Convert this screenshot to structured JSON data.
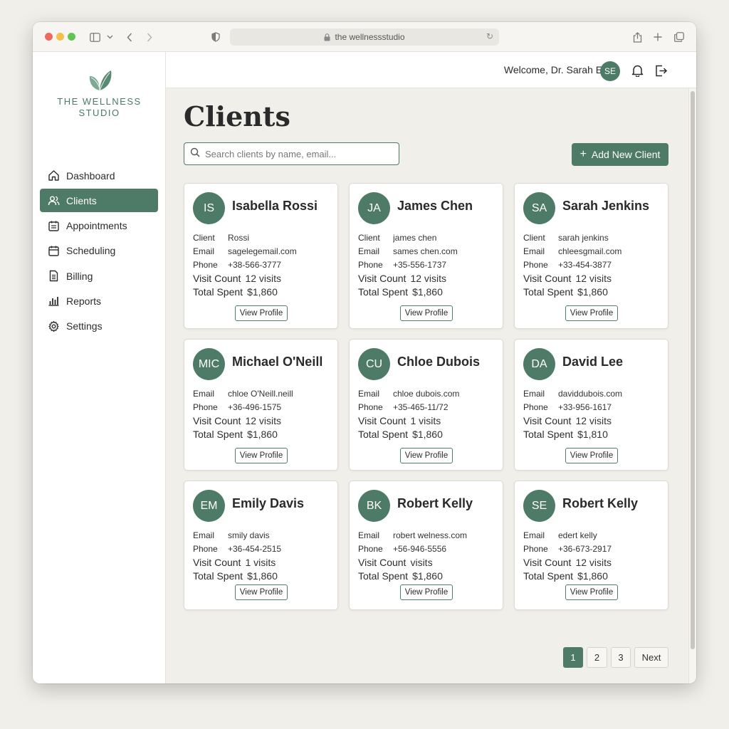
{
  "browser": {
    "url": "the wellnessstudio"
  },
  "brand": {
    "name_line1": "THE WELLNESS",
    "name_line2": "STUDIO",
    "accent_color": "#4e7b67"
  },
  "sidebar": {
    "items": [
      {
        "label": "Dashboard",
        "icon": "home-icon",
        "active": false
      },
      {
        "label": "Clients",
        "icon": "users-icon",
        "active": true
      },
      {
        "label": "Appointments",
        "icon": "calendar-list-icon",
        "active": false
      },
      {
        "label": "Scheduling",
        "icon": "calendar-icon",
        "active": false
      },
      {
        "label": "Billing",
        "icon": "document-icon",
        "active": false
      },
      {
        "label": "Reports",
        "icon": "bar-chart-icon",
        "active": false
      },
      {
        "label": "Settings",
        "icon": "gear-icon",
        "active": false
      }
    ]
  },
  "header": {
    "welcome": "Welcome, Dr. Sarah E.",
    "avatar_initials": "SE"
  },
  "main": {
    "title": "Clients",
    "search_placeholder": "Search clients by name, email...",
    "add_button": "Add New Client",
    "view_profile_label": "View Profile"
  },
  "labels": {
    "client": "Client",
    "email": "Email",
    "phone": "Phone",
    "visit_count": "Visit Count",
    "total_spent": "Total Spent"
  },
  "clients": [
    {
      "initials": "IS",
      "name": "Isabella Rossi",
      "client": "Rossi",
      "email": "sagelegemail.com",
      "phone": "+38-566-3777",
      "visits": "12 visits",
      "spent": "$1,860"
    },
    {
      "initials": "JA",
      "name": "James Chen",
      "client": "james chen",
      "email": "sames chen.com",
      "phone": "+35-556-1737",
      "visits": "12 visits",
      "spent": "$1,860"
    },
    {
      "initials": "SA",
      "name": "Sarah Jenkins",
      "client": "sarah jenkins",
      "email": "chleesgmail.com",
      "phone": "+33-454-3877",
      "visits": "12 visits",
      "spent": "$1,860"
    },
    {
      "initials": "MIC",
      "name": "Michael O'Neill",
      "email": "chloe O'Neill.neill",
      "phone": "+36-496-1575",
      "visits": "12 visits",
      "spent": "$1,860"
    },
    {
      "initials": "CU",
      "name": "Chloe Dubois",
      "email": "chloe dubois.com",
      "phone": "+35-465-11/72",
      "visits": "1 visits",
      "spent": "$1,860"
    },
    {
      "initials": "DA",
      "name": "David Lee",
      "email": "daviddubois.com",
      "phone": "+33-956-1617",
      "visits": "12 visits",
      "spent": "$1,810"
    },
    {
      "initials": "EM",
      "name": "Emily Davis",
      "email": "smily davis",
      "phone": "+36-454-2515",
      "visits": "1 visits",
      "spent": "$1,860"
    },
    {
      "initials": "BK",
      "name": "Robert Kelly",
      "email": "robert welness.com",
      "phone": "+56-946-5556",
      "visits": "visits",
      "spent": "$1,860"
    },
    {
      "initials": "SE",
      "name": "Robert Kelly",
      "email": "edert kelly",
      "phone": "+36-673-2917",
      "visits": "12 visits",
      "spent": "$1,860"
    }
  ],
  "pagination": {
    "pages": [
      "1",
      "2",
      "3"
    ],
    "current": "1",
    "next_label": "Next"
  }
}
